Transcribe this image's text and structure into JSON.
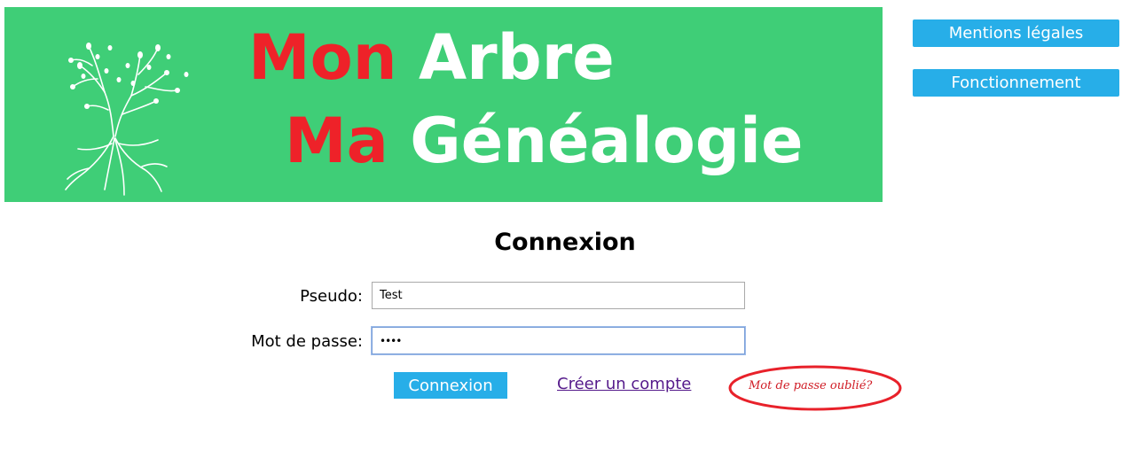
{
  "colors": {
    "banner_bg": "#3fce77",
    "title_red": "#ee2229",
    "accent": "#27aee8",
    "forgot_red": "#d01c25"
  },
  "header": {
    "logo_icon": "tree-icon",
    "title_line1": {
      "red": "Mon",
      "white": "Arbre"
    },
    "title_line2": {
      "red": "Ma",
      "white": "Généalogie"
    }
  },
  "nav": {
    "legal_label": "Mentions légales",
    "how_it_works_label": "Fonctionnement"
  },
  "login": {
    "title": "Connexion",
    "pseudo_label": "Pseudo:",
    "pseudo_value": "Test",
    "password_label": "Mot de passe:",
    "password_value": "••••",
    "submit_label": "Connexion",
    "create_account_label": "Créer un compte",
    "forgot_password_label": "Mot de passe oublié?"
  }
}
